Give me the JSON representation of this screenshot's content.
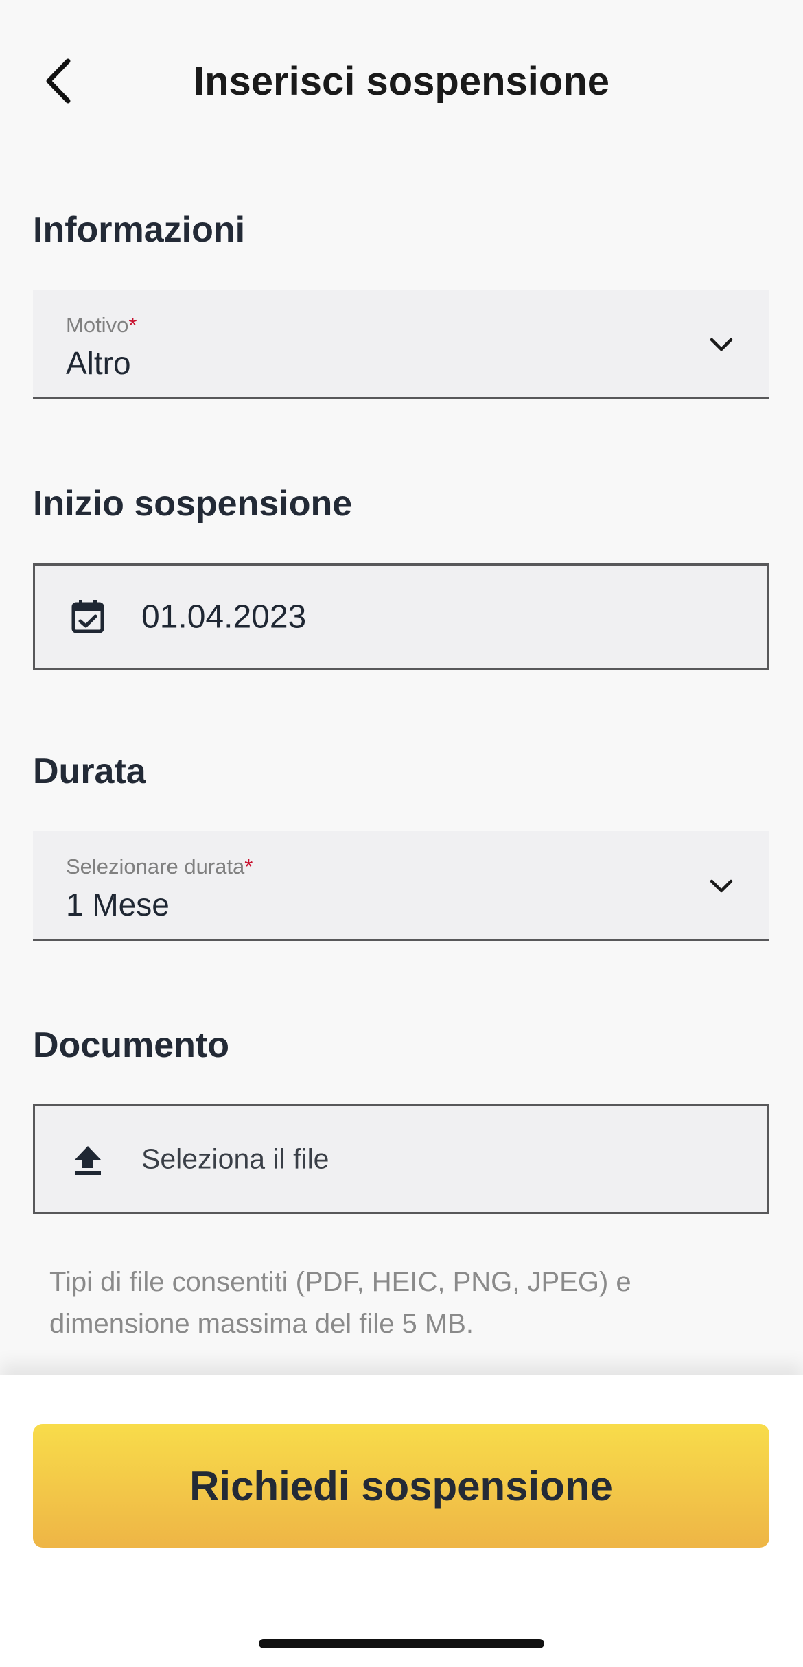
{
  "header": {
    "title": "Inserisci sospensione"
  },
  "sections": {
    "info": {
      "title": "Informazioni",
      "motivo": {
        "label": "Motivo",
        "required_mark": "*",
        "value": "Altro"
      }
    },
    "start": {
      "title": "Inizio sospensione",
      "date_value": "01.04.2023"
    },
    "duration": {
      "title": "Durata",
      "select": {
        "label": "Selezionare durata",
        "required_mark": "*",
        "value": "1 Mese"
      }
    },
    "document": {
      "title": "Documento",
      "upload_label": "Seleziona il file",
      "hint": "Tipi di file consentiti (PDF, HEIC, PNG, JPEG) e dimensione massima del file 5 MB."
    }
  },
  "footer": {
    "cta_label": "Richiedi sospensione"
  },
  "icons": {
    "back": "chevron-left-icon",
    "dropdown": "chevron-down-icon",
    "calendar": "calendar-check-icon",
    "upload": "upload-icon"
  },
  "colors": {
    "required": "#c8102e",
    "cta_top": "#f8dc4a",
    "cta_bottom": "#eeb546",
    "field_bg": "#f0f0f2"
  }
}
